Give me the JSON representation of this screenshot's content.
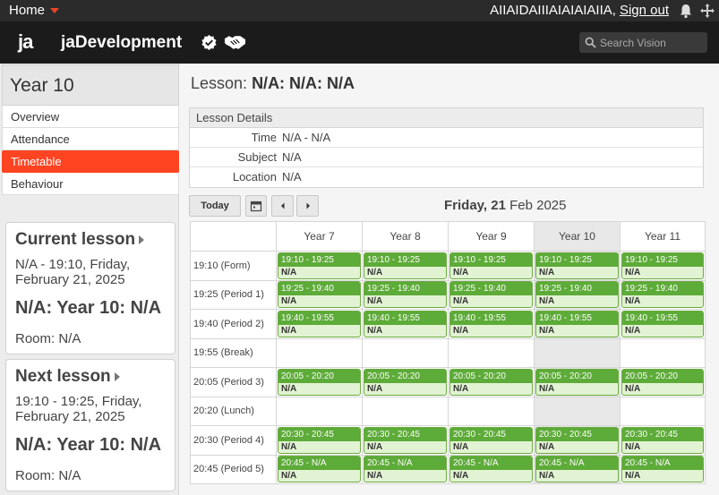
{
  "topbar": {
    "home_label": "Home",
    "user_name": "AIIAIDAIIIAIAIAIAIIA,",
    "sign_out_label": "Sign out",
    "icons": [
      "bell-icon",
      "move-icon"
    ]
  },
  "header": {
    "logo_text": "ja",
    "app_name": "jaDevelopment",
    "search_placeholder": "Search Vision",
    "icons": [
      "verified-icon",
      "handshake-icon",
      "search-icon"
    ]
  },
  "sidebar": {
    "title": "Year 10",
    "nav": [
      {
        "label": "Overview"
      },
      {
        "label": "Attendance"
      },
      {
        "label": "Timetable",
        "active": true
      },
      {
        "label": "Behaviour"
      }
    ],
    "current_lesson": {
      "heading": "Current lesson",
      "time": "N/A - 19:10, Friday, February 21, 2025",
      "name": "N/A: Year 10: N/A",
      "room": "Room: N/A"
    },
    "next_lesson": {
      "heading": "Next lesson",
      "time": "19:10 - 19:25, Friday, February 21, 2025",
      "name": "N/A: Year 10: N/A",
      "room": "Room: N/A"
    }
  },
  "main": {
    "lesson_prefix": "Lesson:",
    "lesson_name": "N/A: N/A: N/A",
    "details": {
      "heading": "Lesson Details",
      "rows": [
        {
          "label": "Time",
          "value": "N/A - N/A"
        },
        {
          "label": "Subject",
          "value": "N/A"
        },
        {
          "label": "Location",
          "value": "N/A"
        }
      ]
    },
    "toolbar": {
      "today_label": "Today",
      "date_day": "Friday, 21",
      "date_rest": "Feb 2025",
      "icons": [
        "calendar-icon",
        "chevron-left-icon",
        "chevron-right-icon"
      ]
    },
    "timetable": {
      "columns": [
        "Year 7",
        "Year 8",
        "Year 9",
        "Year 10",
        "Year 11"
      ],
      "highlight_column": "Year 10",
      "rows": [
        {
          "period": "19:10 (Form)",
          "slot": "19:10 - 19:25",
          "name": "N/A"
        },
        {
          "period": "19:25 (Period 1)",
          "slot": "19:25 - 19:40",
          "name": "N/A"
        },
        {
          "period": "19:40 (Period 2)",
          "slot": "19:40 - 19:55",
          "name": "N/A"
        },
        {
          "period": "19:55 (Break)",
          "slot": null,
          "name": null
        },
        {
          "period": "20:05 (Period 3)",
          "slot": "20:05 - 20:20",
          "name": "N/A"
        },
        {
          "period": "20:20 (Lunch)",
          "slot": null,
          "name": null
        },
        {
          "period": "20:30 (Period 4)",
          "slot": "20:30 - 20:45",
          "name": "N/A"
        },
        {
          "period": "20:45 (Period 5)",
          "slot": "20:45 - N/A",
          "name": "N/A"
        }
      ]
    }
  },
  "colors": {
    "accent": "#ff4422",
    "lesson_header": "#5dab38",
    "lesson_body": "#e2f3d3",
    "topbar": "#2b2b2b",
    "header": "#1b1b1b"
  }
}
